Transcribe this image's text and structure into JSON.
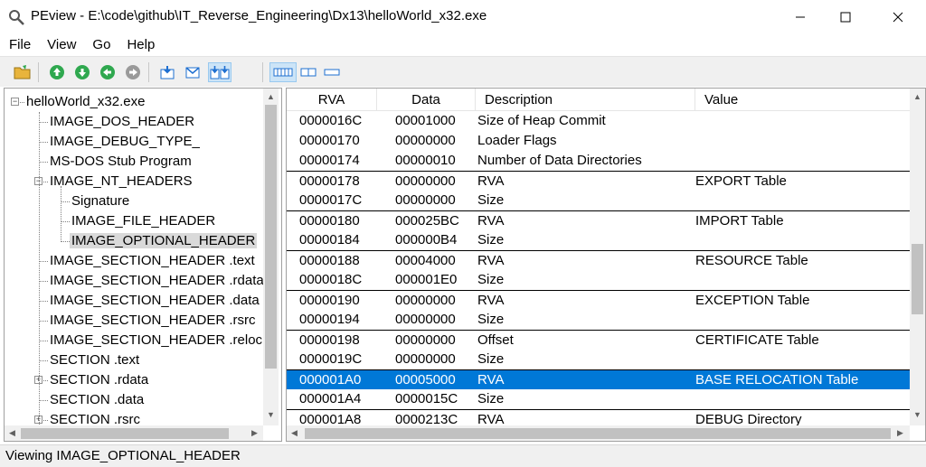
{
  "window": {
    "title": "PEview - E:\\code\\github\\IT_Reverse_Engineering\\Dx13\\helloWorld_x32.exe"
  },
  "menu": [
    "File",
    "View",
    "Go",
    "Help"
  ],
  "toolbar": {
    "buttons": [
      "open-folder-icon",
      "go-up-icon",
      "go-down-icon",
      "go-back-icon",
      "go-forward-icon",
      "view-header-icon",
      "view-mail-icon",
      "view-split-icon",
      "view-wide-icon",
      "view-medium-icon",
      "view-narrow-icon"
    ]
  },
  "tree": {
    "items": [
      {
        "label": "helloWorld_x32.exe",
        "depth": 0,
        "expander": "-"
      },
      {
        "label": "IMAGE_DOS_HEADER",
        "depth": 1,
        "expander": ""
      },
      {
        "label": "IMAGE_DEBUG_TYPE_",
        "depth": 1,
        "expander": ""
      },
      {
        "label": "MS-DOS Stub Program",
        "depth": 1,
        "expander": ""
      },
      {
        "label": "IMAGE_NT_HEADERS",
        "depth": 1,
        "expander": "-"
      },
      {
        "label": "Signature",
        "depth": 2,
        "expander": ""
      },
      {
        "label": "IMAGE_FILE_HEADER",
        "depth": 2,
        "expander": ""
      },
      {
        "label": "IMAGE_OPTIONAL_HEADER",
        "depth": 2,
        "expander": "",
        "selected": true
      },
      {
        "label": "IMAGE_SECTION_HEADER .text",
        "depth": 1,
        "expander": ""
      },
      {
        "label": "IMAGE_SECTION_HEADER .rdata",
        "depth": 1,
        "expander": ""
      },
      {
        "label": "IMAGE_SECTION_HEADER .data",
        "depth": 1,
        "expander": ""
      },
      {
        "label": "IMAGE_SECTION_HEADER .rsrc",
        "depth": 1,
        "expander": ""
      },
      {
        "label": "IMAGE_SECTION_HEADER .reloc",
        "depth": 1,
        "expander": ""
      },
      {
        "label": "SECTION .text",
        "depth": 1,
        "expander": ""
      },
      {
        "label": "SECTION .rdata",
        "depth": 1,
        "expander": "+"
      },
      {
        "label": "SECTION .data",
        "depth": 1,
        "expander": ""
      },
      {
        "label": "SECTION .rsrc",
        "depth": 1,
        "expander": "+"
      }
    ]
  },
  "table": {
    "columns": [
      "RVA",
      "Data",
      "Description",
      "Value"
    ],
    "rows": [
      {
        "rva": "0000016C",
        "data": "00001000",
        "desc": "Size of Heap Commit",
        "value": ""
      },
      {
        "rva": "00000170",
        "data": "00000000",
        "desc": "Loader Flags",
        "value": ""
      },
      {
        "rva": "00000174",
        "data": "00000010",
        "desc": "Number of Data Directories",
        "value": ""
      },
      {
        "rva": "00000178",
        "data": "00000000",
        "desc": "RVA",
        "value": "EXPORT Table",
        "group_top": true
      },
      {
        "rva": "0000017C",
        "data": "00000000",
        "desc": "Size",
        "value": ""
      },
      {
        "rva": "00000180",
        "data": "000025BC",
        "desc": "RVA",
        "value": "IMPORT Table",
        "group_top": true
      },
      {
        "rva": "00000184",
        "data": "000000B4",
        "desc": "Size",
        "value": ""
      },
      {
        "rva": "00000188",
        "data": "00004000",
        "desc": "RVA",
        "value": "RESOURCE Table",
        "group_top": true
      },
      {
        "rva": "0000018C",
        "data": "000001E0",
        "desc": "Size",
        "value": ""
      },
      {
        "rva": "00000190",
        "data": "00000000",
        "desc": "RVA",
        "value": "EXCEPTION Table",
        "group_top": true
      },
      {
        "rva": "00000194",
        "data": "00000000",
        "desc": "Size",
        "value": ""
      },
      {
        "rva": "00000198",
        "data": "00000000",
        "desc": "Offset",
        "value": "CERTIFICATE Table",
        "group_top": true
      },
      {
        "rva": "0000019C",
        "data": "00000000",
        "desc": "Size",
        "value": ""
      },
      {
        "rva": "000001A0",
        "data": "00005000",
        "desc": "RVA",
        "value": "BASE RELOCATION Table",
        "group_top": true,
        "selected": true
      },
      {
        "rva": "000001A4",
        "data": "0000015C",
        "desc": "Size",
        "value": ""
      },
      {
        "rva": "000001A8",
        "data": "0000213C",
        "desc": "RVA",
        "value": "DEBUG Directory",
        "group_top": true
      }
    ]
  },
  "status": {
    "text": "Viewing IMAGE_OPTIONAL_HEADER"
  },
  "colors": {
    "selection": "#0078d7",
    "toolbar_green": "#2fa84f",
    "toolbar_blue": "#1e6fd0"
  }
}
